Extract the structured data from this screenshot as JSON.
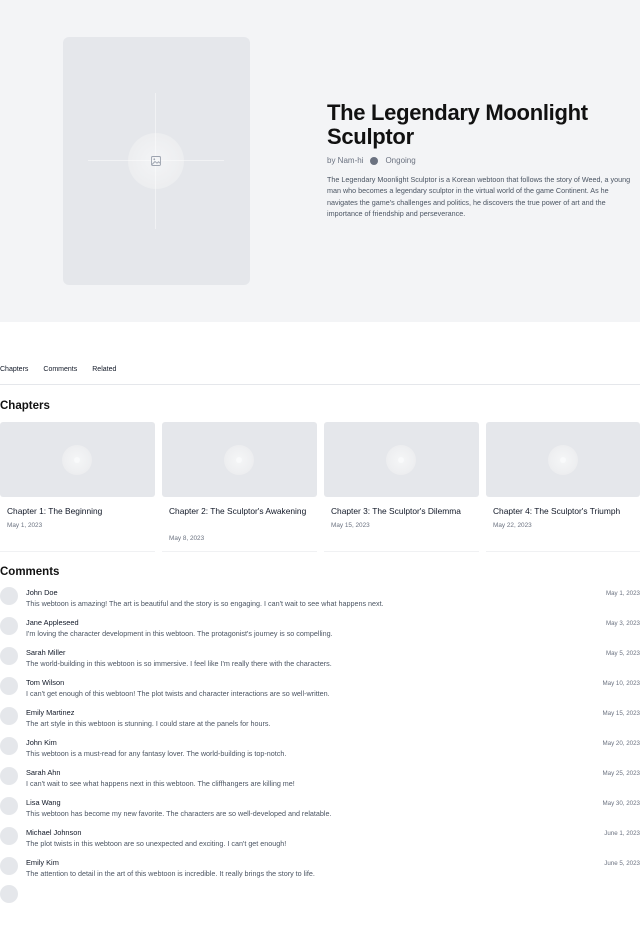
{
  "series": {
    "title": "The Legendary Moonlight Sculptor",
    "author": "by Nam-hi",
    "status": "Ongoing",
    "description": "The Legendary Moonlight Sculptor is a Korean webtoon that follows the story of Weed, a young man who becomes a legendary sculptor in the virtual world of the game Continent. As he navigates the game's challenges and politics, he discovers the true power of art and the importance of friendship and perseverance."
  },
  "tabs": [
    {
      "label": "Chapters"
    },
    {
      "label": "Comments"
    },
    {
      "label": "Related"
    }
  ],
  "sections": {
    "chapters_heading": "Chapters",
    "comments_heading": "Comments"
  },
  "chapters": [
    {
      "title": "Chapter 1: The Beginning",
      "date": "May 1, 2023"
    },
    {
      "title": "Chapter 2: The Sculptor's Awakening",
      "date": "May 8, 2023"
    },
    {
      "title": "Chapter 3: The Sculptor's Dilemma",
      "date": "May 15, 2023"
    },
    {
      "title": "Chapter 4: The Sculptor's Triumph",
      "date": "May 22, 2023"
    }
  ],
  "comments": [
    {
      "name": "John Doe",
      "text": "This webtoon is amazing! The art is beautiful and the story is so engaging. I can't wait to see what happens next.",
      "date": "May 1, 2023"
    },
    {
      "name": "Jane Appleseed",
      "text": "I'm loving the character development in this webtoon. The protagonist's journey is so compelling.",
      "date": "May 3, 2023"
    },
    {
      "name": "Sarah Miller",
      "text": "The world-building in this webtoon is so immersive. I feel like I'm really there with the characters.",
      "date": "May 5, 2023"
    },
    {
      "name": "Tom Wilson",
      "text": "I can't get enough of this webtoon! The plot twists and character interactions are so well-written.",
      "date": "May 10, 2023"
    },
    {
      "name": "Emily Martinez",
      "text": "The art style in this webtoon is stunning. I could stare at the panels for hours.",
      "date": "May 15, 2023"
    },
    {
      "name": "John Kim",
      "text": "This webtoon is a must-read for any fantasy lover. The world-building is top-notch.",
      "date": "May 20, 2023"
    },
    {
      "name": "Sarah Ahn",
      "text": "I can't wait to see what happens next in this webtoon. The cliffhangers are killing me!",
      "date": "May 25, 2023"
    },
    {
      "name": "Lisa Wang",
      "text": "This webtoon has become my new favorite. The characters are so well-developed and relatable.",
      "date": "May 30, 2023"
    },
    {
      "name": "Michael Johnson",
      "text": "The plot twists in this webtoon are so unexpected and exciting. I can't get enough!",
      "date": "June 1, 2023"
    },
    {
      "name": "Emily Kim",
      "text": "The attention to detail in the art of this webtoon is incredible. It really brings the story to life.",
      "date": "June 5, 2023"
    }
  ],
  "icons": {
    "cover_placeholder": "image-icon",
    "status_dot": "dot-icon"
  },
  "colors": {
    "hero_bg": "#f3f4f6",
    "placeholder": "#e5e7eb",
    "text_muted": "#6b7280"
  }
}
